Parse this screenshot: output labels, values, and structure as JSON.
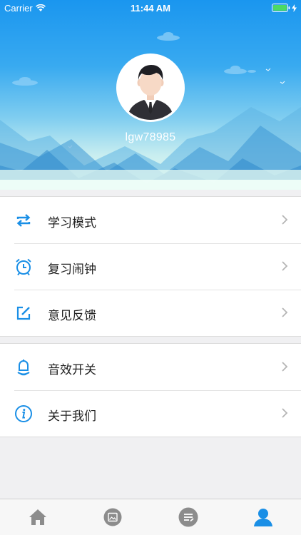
{
  "status_bar": {
    "carrier": "Carrier",
    "time": "11:44 AM",
    "battery_level": 1.0
  },
  "profile": {
    "username": "lgw78985"
  },
  "menu": {
    "group1": [
      {
        "label": "学习模式",
        "icon": "repeat-icon"
      },
      {
        "label": "复习闹钟",
        "icon": "alarm-clock-icon"
      },
      {
        "label": "意见反馈",
        "icon": "edit-feedback-icon"
      }
    ],
    "group2": [
      {
        "label": "音效开关",
        "icon": "bell-icon"
      },
      {
        "label": "关于我们",
        "icon": "info-icon"
      }
    ]
  },
  "tab_bar": {
    "tabs": [
      {
        "icon": "home-icon",
        "active": false
      },
      {
        "icon": "image-card-icon",
        "active": false
      },
      {
        "icon": "notes-list-icon",
        "active": false
      },
      {
        "icon": "user-profile-icon",
        "active": true
      }
    ]
  },
  "colors": {
    "accent": "#1a8fe6",
    "tab_inactive": "#8c8c8c",
    "header_top": "#1a96ef"
  }
}
